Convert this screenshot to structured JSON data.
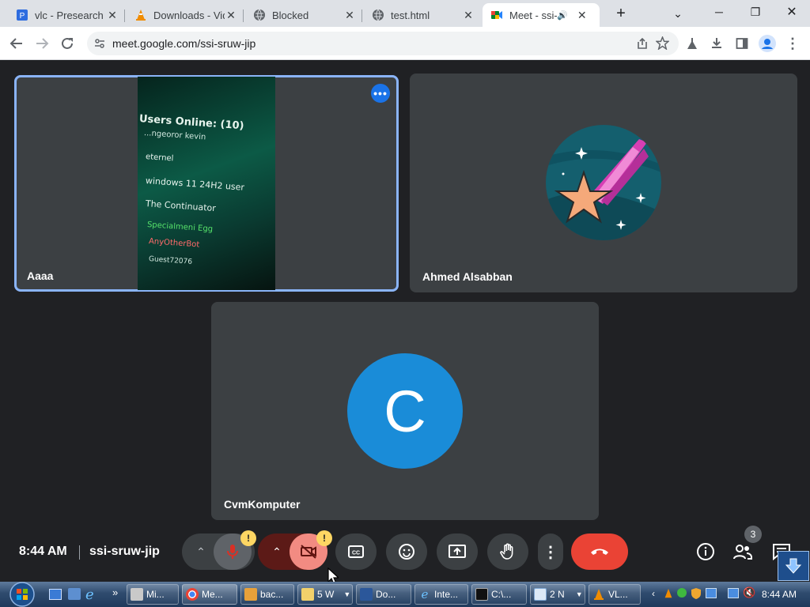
{
  "browser": {
    "tabs": [
      {
        "title": "vlc - Presearch",
        "icon": "presearch-icon",
        "active": false
      },
      {
        "title": "Downloads - VideoLAN",
        "icon": "vlc-cone-icon",
        "active": false
      },
      {
        "title": "Blocked",
        "icon": "globe-icon",
        "active": false
      },
      {
        "title": "test.html",
        "icon": "globe-icon",
        "active": false
      },
      {
        "title": "Meet - ssi-sruw-jip",
        "icon": "google-meet-icon",
        "active": true
      }
    ],
    "new_tab_symbol": "+",
    "url": "meet.google.com/ssi-sruw-jip"
  },
  "meet": {
    "participants": [
      {
        "name": "Aaaa",
        "kind": "video"
      },
      {
        "name": "Ahmed Alsabban",
        "kind": "avatar-image"
      },
      {
        "name": "CvmKomputer",
        "kind": "initial",
        "initial": "C",
        "color": "#1a8cd8"
      }
    ],
    "video_text": {
      "heading": "Users Online: (10)",
      "users": [
        "...ngeoror kevin",
        "eternel",
        "windows 11 24H2 user",
        "The Continuator",
        "Specialmeni Egg",
        "AnyOtherBot",
        "Guest72076"
      ]
    },
    "time": "8:44 AM",
    "meeting_code": "ssi-sruw-jip",
    "mic_warning": "!",
    "cam_warning": "!",
    "people_count": "3",
    "colors": {
      "accent": "#8ab4f8",
      "leave": "#ea4335",
      "muted": "#f28b82",
      "warning": "#fdd663"
    }
  },
  "taskbar": {
    "items": [
      {
        "label": "Mi...",
        "icon": "app-icon"
      },
      {
        "label": "Me...",
        "icon": "chrome-icon",
        "active": true
      },
      {
        "label": "bac...",
        "icon": "app-icon"
      },
      {
        "label": "5 W",
        "icon": "folder-icon"
      },
      {
        "label": "Do...",
        "icon": "document-icon"
      },
      {
        "label": "Inte...",
        "icon": "ie-icon"
      },
      {
        "label": "C:\\...",
        "icon": "terminal-icon"
      },
      {
        "label": "2 N",
        "icon": "notepad-icon"
      },
      {
        "label": "VL...",
        "icon": "vlc-cone-icon"
      }
    ],
    "time": "8:44 AM"
  }
}
